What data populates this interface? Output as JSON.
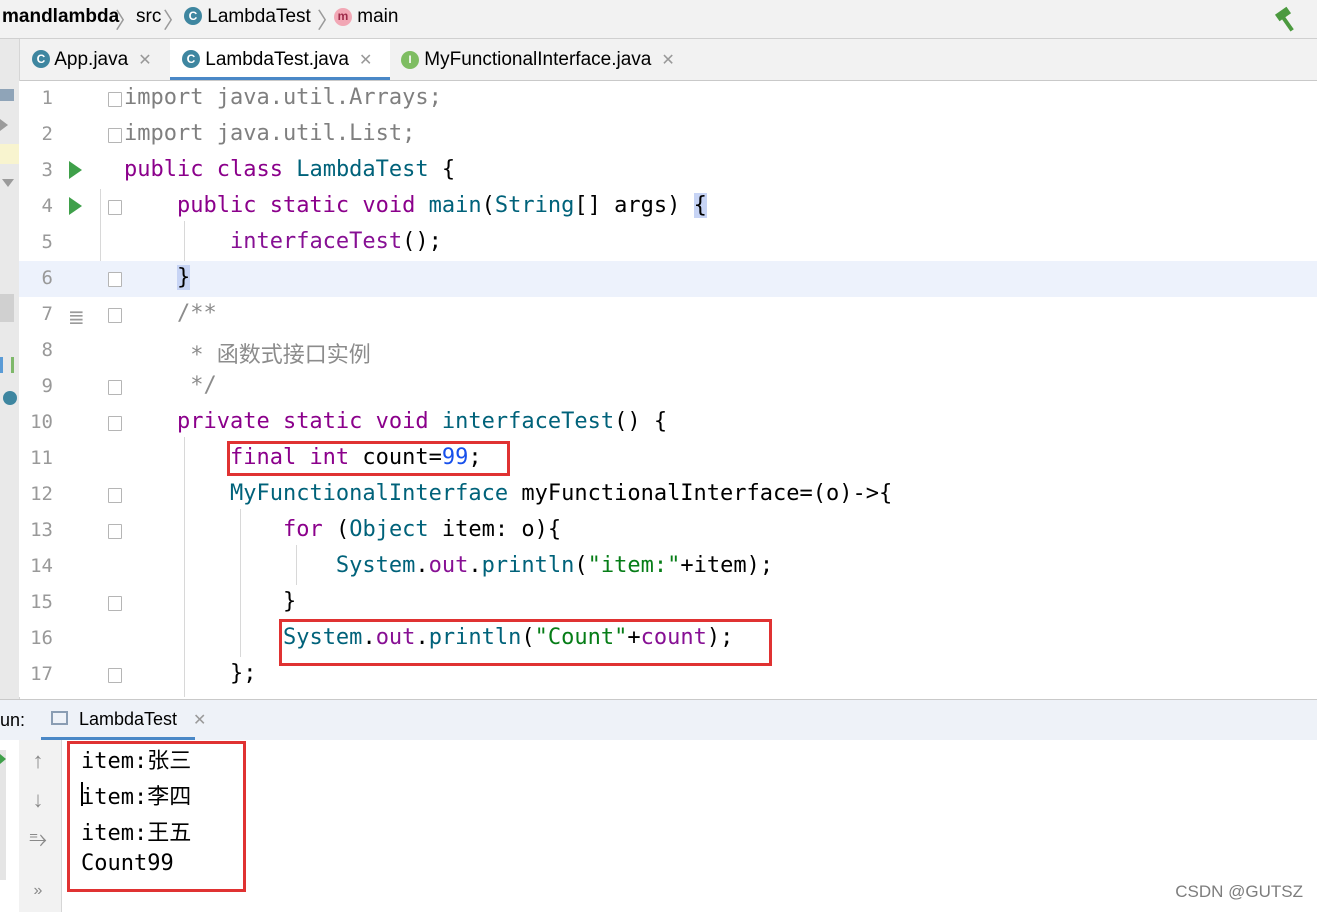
{
  "breadcrumb": {
    "items": [
      "mandlambda",
      "src",
      "LambdaTest",
      "main"
    ],
    "separator": "〉"
  },
  "tabs": [
    {
      "label": "App.java",
      "icon": "class-icon",
      "active": false
    },
    {
      "label": "LambdaTest.java",
      "icon": "class-icon",
      "active": true
    },
    {
      "label": "MyFunctionalInterface.java",
      "icon": "interface-icon",
      "active": false
    }
  ],
  "editor": {
    "line_numbers": [
      "1",
      "2",
      "3",
      "4",
      "5",
      "6",
      "7",
      "8",
      "9",
      "10",
      "11",
      "12",
      "13",
      "14",
      "15",
      "16",
      "17"
    ],
    "lines": [
      "import java.util.Arrays;",
      "import java.util.List;",
      "public class LambdaTest {",
      "    public static void main(String[] args) {",
      "        interfaceTest();",
      "    }",
      "    /**",
      "     * 函数式接口实例",
      "     */",
      "    private static void interfaceTest() {",
      "        final int count=99;",
      "        MyFunctionalInterface myFunctionalInterface=(o)->{",
      "            for (Object item: o){",
      "                System.out.println(\"item:\"+item);",
      "            }",
      "            System.out.println(\"Count\"+count);",
      "        };"
    ],
    "current_line": "6"
  },
  "run_panel": {
    "label": "un:",
    "tab_label": "LambdaTest",
    "output": [
      "item:张三",
      "item:李四",
      "item:王五",
      "Count99"
    ]
  },
  "watermark": "CSDN @GUTSZ",
  "colors": {
    "keyword": "#000080",
    "string": "#067d17",
    "number": "#1750eb",
    "highlight_box": "#e03232",
    "run_icon": "#3fa04a"
  }
}
